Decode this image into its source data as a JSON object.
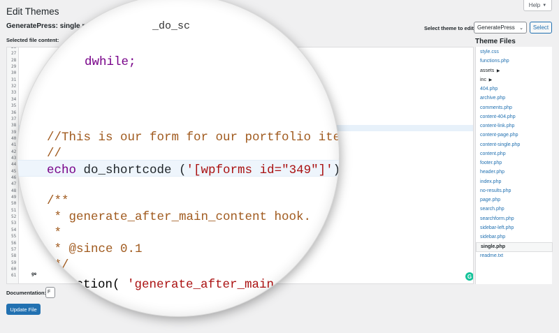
{
  "header": {
    "page_title": "Edit Themes",
    "file_title": "GeneratePress: single.php",
    "selected_label": "Selected file content:",
    "help_label": "Help"
  },
  "theme_select": {
    "label": "Select theme to edit:",
    "value": "GeneratePress",
    "button": "Select"
  },
  "theme_files": {
    "title": "Theme Files",
    "items": [
      {
        "label": "style.css",
        "type": "file"
      },
      {
        "label": "functions.php",
        "type": "file"
      },
      {
        "label": "assets",
        "type": "folder"
      },
      {
        "label": "inc",
        "type": "folder"
      },
      {
        "label": "404.php",
        "type": "file"
      },
      {
        "label": "archive.php",
        "type": "file"
      },
      {
        "label": "comments.php",
        "type": "file"
      },
      {
        "label": "content-404.php",
        "type": "file"
      },
      {
        "label": "content-link.php",
        "type": "file"
      },
      {
        "label": "content-page.php",
        "type": "file"
      },
      {
        "label": "content-single.php",
        "type": "file"
      },
      {
        "label": "content.php",
        "type": "file"
      },
      {
        "label": "footer.php",
        "type": "file"
      },
      {
        "label": "header.php",
        "type": "file"
      },
      {
        "label": "index.php",
        "type": "file"
      },
      {
        "label": "no-results.php",
        "type": "file"
      },
      {
        "label": "page.php",
        "type": "file"
      },
      {
        "label": "search.php",
        "type": "file"
      },
      {
        "label": "searchform.php",
        "type": "file"
      },
      {
        "label": "sidebar-left.php",
        "type": "file"
      },
      {
        "label": "sidebar.php",
        "type": "file"
      },
      {
        "label": "single.php",
        "type": "current"
      },
      {
        "label": "readme.txt",
        "type": "file"
      }
    ]
  },
  "editor": {
    "line_numbers": [
      "26",
      "27",
      "28",
      "29",
      "30",
      "31",
      "32",
      "33",
      "34",
      "35",
      "36",
      "37",
      "38",
      "39",
      "40",
      "41",
      "42",
      "43",
      "44",
      "45",
      "46",
      "47",
      "48",
      "49",
      "50",
      "51",
      "52",
      "53",
      "54",
      "55",
      "56",
      "57",
      "58",
      "59",
      "60",
      "61"
    ],
    "small_text_the": "the",
    "small_text_ge": "ge",
    "grammarly_glyph": "G"
  },
  "magnified_code": {
    "top_fragment": "_do_sc",
    "endwhile": "dwhile;",
    "comment1": "//This is our form for our portfolio items",
    "comment2": "//",
    "echo_kw": "echo",
    "echo_fn": " do_shortcode (",
    "echo_str": "'[wpforms id=\"349\"]'",
    "echo_end": ");",
    "doc_open": "/**",
    "doc_line1": " * generate_after_main_content hook.",
    "doc_line2": " *",
    "doc_line3": " * @since 0.1",
    "doc_close": " */",
    "action_fn": "o_action(",
    "action_str": " 'generate_after_main_conten"
  },
  "footer": {
    "doc_label": "Documentation:",
    "doc_select_value": "F",
    "update_button": "Update File"
  }
}
